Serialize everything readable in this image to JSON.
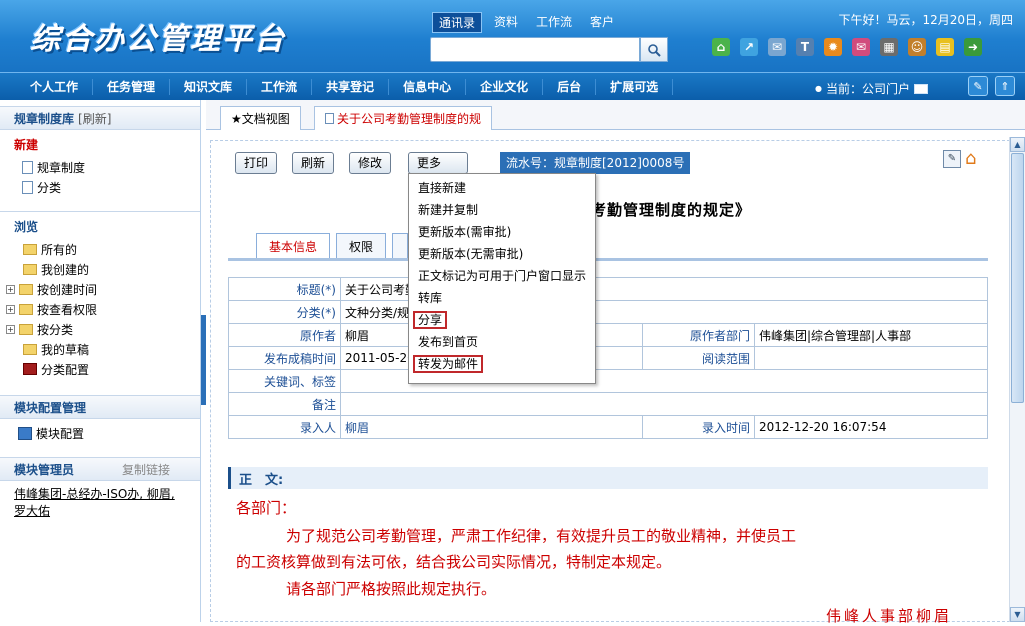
{
  "header": {
    "logo": "综合办公管理平台",
    "quick_tabs": [
      "通讯录",
      "资料",
      "工作流",
      "客户"
    ],
    "greeting": "下午好！马云，12月20日，周四",
    "icons": [
      "home-icon",
      "share-icon",
      "mail-icon",
      "shirt-icon",
      "gear-icon",
      "message-icon",
      "calendar-icon",
      "person-icon",
      "note-icon",
      "exit-icon"
    ]
  },
  "nav": {
    "items": [
      "个人工作",
      "任务管理",
      "知识文库",
      "工作流",
      "共享登记",
      "信息中心",
      "企业文化",
      "后台",
      "扩展可选"
    ],
    "current": "当前：公司门户"
  },
  "sidebar": {
    "title": "规章制度库",
    "refresh": "[刷新]",
    "new_title": "新建",
    "new_items": [
      "规章制度",
      "分类"
    ],
    "browse_title": "浏览",
    "browse_items": [
      "所有的",
      "我创建的",
      "按创建时间",
      "按查看权限",
      "按分类",
      "我的草稿",
      "分类配置"
    ],
    "module_config_title": "模块配置管理",
    "module_config_item": "模块配置",
    "admin_title": "模块管理员",
    "copy_link": "复制链接",
    "admins": "伟峰集团-总经办-ISO办, 柳眉, 罗大佑"
  },
  "tabs": {
    "doc_view": "★文档视图",
    "doc_tab": "关于公司考勤管理制度的规"
  },
  "toolbar": {
    "print": "打印",
    "refresh": "刷新",
    "edit": "修改",
    "more": "更多>>",
    "serial": "流水号：规章制度[2012]0008号"
  },
  "document": {
    "title_fragment": "司考勤管理制度的规定》"
  },
  "inner_tabs": [
    "基本信息",
    "权限"
  ],
  "info": {
    "title_label": "标题(*)",
    "title_value": "关于公司考勤",
    "category_label": "分类(*)",
    "category_value": "文种分类/规",
    "author_label": "原作者",
    "author_value": "柳眉",
    "author_dept_label": "原作者部门",
    "author_dept_value": "伟峰集团|综合管理部|人事部",
    "publish_label": "发布成稿时间",
    "publish_value": "2011-05-20",
    "read_scope_label": "阅读范围",
    "keywords_label": "关键词、标签",
    "remark_label": "备注",
    "entered_by_label": "录入人",
    "entered_by_value": "柳眉",
    "entered_time_label": "录入时间",
    "entered_time_value": "2012-12-20 16:07:54"
  },
  "body": {
    "heading": "正　文:",
    "salutation": "各部门：",
    "para1_line1": "为了规范公司考勤管理，严肃工作纪律，有效提升员工的敬业精神，并使员工",
    "para1_line2": "的工资核算做到有法可依，结合我公司实际情况，特制定本规定。",
    "para2": "请各部门严格按照此规定执行。",
    "signature": "伟峰人事部柳眉"
  },
  "dropdown": {
    "items": [
      "直接新建",
      "新建并复制",
      "更新版本(需审批)",
      "更新版本(无需审批)",
      "正文标记为可用于门户窗口显示",
      "转库",
      "分享",
      "发布到首页",
      "转发为邮件"
    ],
    "highlighted": [
      "分享",
      "转发为邮件"
    ]
  }
}
